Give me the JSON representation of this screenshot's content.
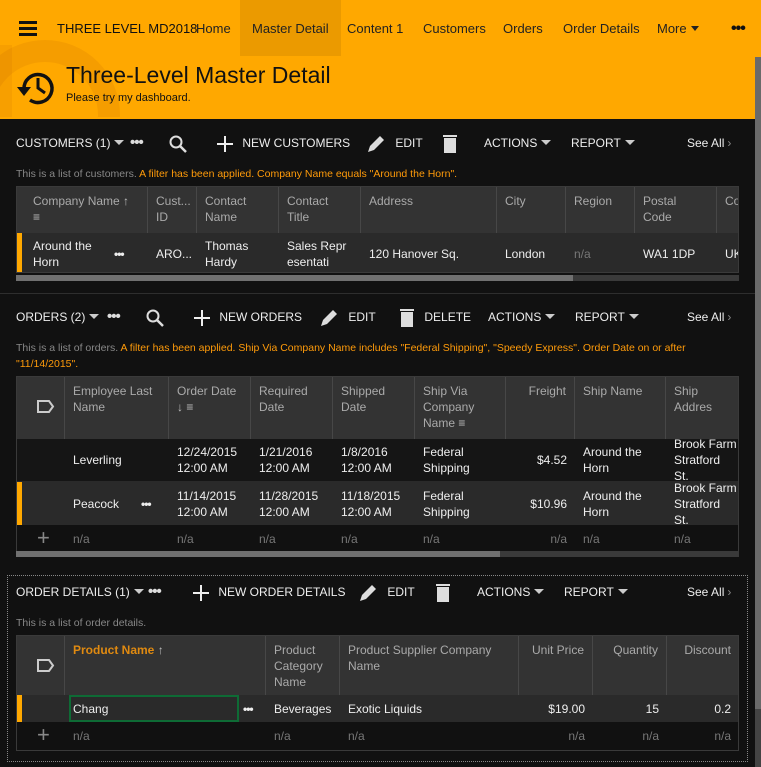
{
  "app": {
    "title": "THREE LEVEL MD2018"
  },
  "nav": {
    "items": [
      {
        "label": "Home"
      },
      {
        "label": "Master Detail",
        "active": true
      },
      {
        "label": "Content 1"
      },
      {
        "label": "Customers"
      },
      {
        "label": "Orders"
      },
      {
        "label": "Order Details"
      },
      {
        "label": "More"
      }
    ],
    "overflow_icon": "more-dots-icon"
  },
  "page": {
    "title": "Three-Level Master Detail",
    "subtitle": "Please try my dashboard.",
    "icon": "history-icon"
  },
  "colors": {
    "accent": "#ffa800",
    "filter_text": "#ff9b0a",
    "background": "#111111",
    "header_row": "#333333",
    "focus_border": "#0e6b35"
  },
  "customers": {
    "title": "CUSTOMERS (1)",
    "new_label": "NEW CUSTOMERS",
    "edit_label": "EDIT",
    "actions_label": "ACTIONS",
    "report_label": "REPORT",
    "see_all": "See All",
    "desc": "This is a list of customers.",
    "filter": "A filter has been applied. Company Name equals \"Around the Horn\".",
    "columns": [
      "Company Name",
      "Cust... ID",
      "Contact Name",
      "Contact Title",
      "Address",
      "City",
      "Region",
      "Postal Code",
      "Co"
    ],
    "rows": [
      {
        "company": "Around the Horn",
        "id": "ARO...",
        "contact": "Thomas Hardy",
        "title": "Sales Representati",
        "address": "120 Hanover Sq.",
        "city": "London",
        "region": "n/a",
        "postal": "WA1 1DP",
        "country": "UK"
      }
    ],
    "scroll_fraction": 0.77
  },
  "orders": {
    "title": "ORDERS (2)",
    "new_label": "NEW ORDERS",
    "edit_label": "EDIT",
    "delete_label": "DELETE",
    "actions_label": "ACTIONS",
    "report_label": "REPORT",
    "see_all": "See All",
    "desc": "This is a list of orders.",
    "filter": "A filter has been applied. Ship Via Company Name includes \"Federal Shipping\", \"Speedy Express\". Order Date on or after \"11/14/2015\".",
    "columns": [
      "Employee Last Name",
      "Order Date",
      "Required Date",
      "Shipped Date",
      "Ship Via Company Name",
      "Freight",
      "Ship Name",
      "Ship Addres"
    ],
    "rows": [
      {
        "employee": "Leverling",
        "order_date": "12/24/2015 12:00 AM",
        "required": "1/21/2016 12:00 AM",
        "shipped": "1/8/2016 12:00 AM",
        "ship_via": "Federal Shipping",
        "freight": "$4.52",
        "ship_name": "Around the Horn",
        "ship_address": "Brook Farm Stratford St."
      },
      {
        "employee": "Peacock",
        "order_date": "11/14/2015 12:00 AM",
        "required": "11/28/2015 12:00 AM",
        "shipped": "11/18/2015 12:00 AM",
        "ship_via": "Federal Shipping",
        "freight": "$10.96",
        "ship_name": "Around the Horn",
        "ship_address": "Brook Farm Stratford St."
      }
    ],
    "new_row_placeholder": "n/a",
    "scroll_fraction": 0.67
  },
  "order_details": {
    "title": "ORDER DETAILS (1)",
    "new_label": "NEW ORDER DETAILS",
    "edit_label": "EDIT",
    "actions_label": "ACTIONS",
    "report_label": "REPORT",
    "see_all": "See All",
    "desc": "This is a list of order details.",
    "columns": [
      "Product Name",
      "Product Category Name",
      "Product Supplier Company Name",
      "Unit Price",
      "Quantity",
      "Discount"
    ],
    "rows": [
      {
        "product": "Chang",
        "category": "Beverages",
        "supplier": "Exotic Liquids",
        "unit_price": "$19.00",
        "quantity": "15",
        "discount": "0.2"
      }
    ],
    "new_row_placeholder": "n/a"
  }
}
